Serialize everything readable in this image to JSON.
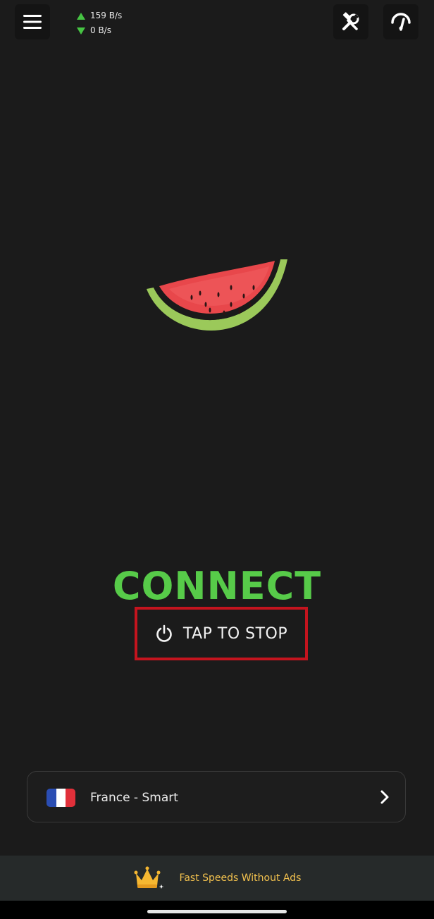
{
  "top_bar": {
    "menu_icon": "hamburger-menu-icon",
    "tools_icon": "tools-icon",
    "speedtest_icon": "speedometer-icon",
    "upload_speed": "159 B/s",
    "download_speed": "0 B/s",
    "accent_color": "#46c443"
  },
  "main": {
    "logo_icon": "watermelon-logo",
    "status_label": "CONNECT",
    "status_color": "#57cb49",
    "action_label": "TAP TO STOP",
    "action_icon": "power-icon",
    "highlight_color": "#c4141e"
  },
  "server": {
    "label": "France - Smart",
    "flag_icon": "france-flag-icon",
    "chevron_icon": "chevron-right-icon"
  },
  "promo": {
    "icon": "crown-icon",
    "label": "Fast Speeds Without Ads",
    "color": "#f2c14e"
  }
}
